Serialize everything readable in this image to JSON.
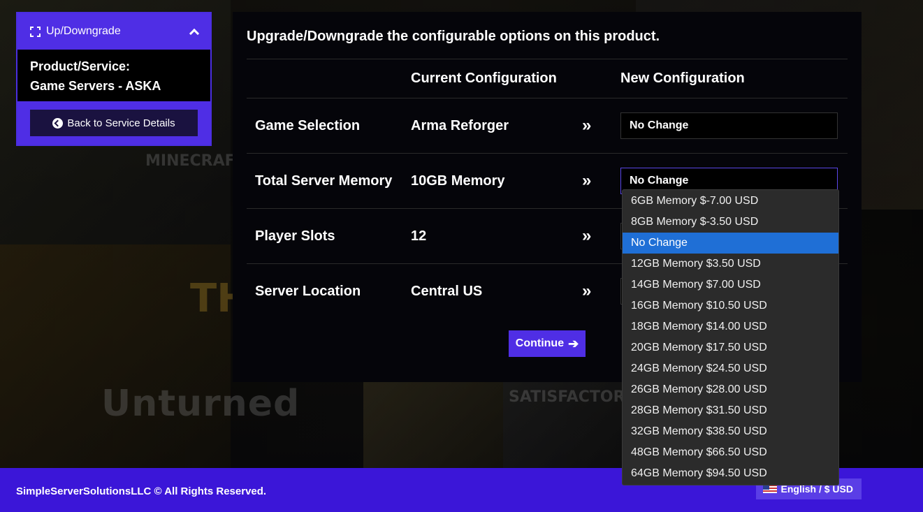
{
  "sidebar": {
    "header_title": "Up/Downgrade",
    "product_label": "Product/Service:",
    "product_name": "Game Servers - ASKA",
    "back_button": "Back to Service Details"
  },
  "main": {
    "title": "Upgrade/Downgrade the configurable options on this product.",
    "headers": {
      "current": "Current Configuration",
      "new": "New Configuration"
    },
    "rows": [
      {
        "name": "Game Selection",
        "current": "Arma Reforger",
        "new": "No Change"
      },
      {
        "name": "Total Server Memory",
        "current": "10GB Memory",
        "new": "No Change"
      },
      {
        "name": "Player Slots",
        "current": "12",
        "new": ""
      },
      {
        "name": "Server Location",
        "current": "Central US",
        "new": ""
      }
    ],
    "arrow_glyph": "»",
    "continue_button": "Continue"
  },
  "dropdown": {
    "options": [
      "6GB Memory $-7.00 USD",
      "8GB Memory $-3.50 USD",
      "No Change",
      "12GB Memory $3.50 USD",
      "14GB Memory $7.00 USD",
      "16GB Memory $10.50 USD",
      "18GB Memory $14.00 USD",
      "20GB Memory $17.50 USD",
      "24GB Memory $24.50 USD",
      "26GB Memory $28.00 USD",
      "28GB Memory $31.50 USD",
      "32GB Memory $38.50 USD",
      "48GB Memory $66.50 USD",
      "64GB Memory $94.50 USD"
    ],
    "selected_index": 2
  },
  "background": {
    "words": [
      "MINECRAFT",
      "THE FO",
      "Unturned",
      "SATISFACTORY"
    ]
  },
  "footer": {
    "copyright": "SimpleServerSolutionsLLC © All Rights Reserved.",
    "language": "English / $ USD"
  },
  "colors": {
    "brand": "#4f2ee5",
    "footer": "#3b16d8",
    "selected_option": "#1f6fd6"
  }
}
